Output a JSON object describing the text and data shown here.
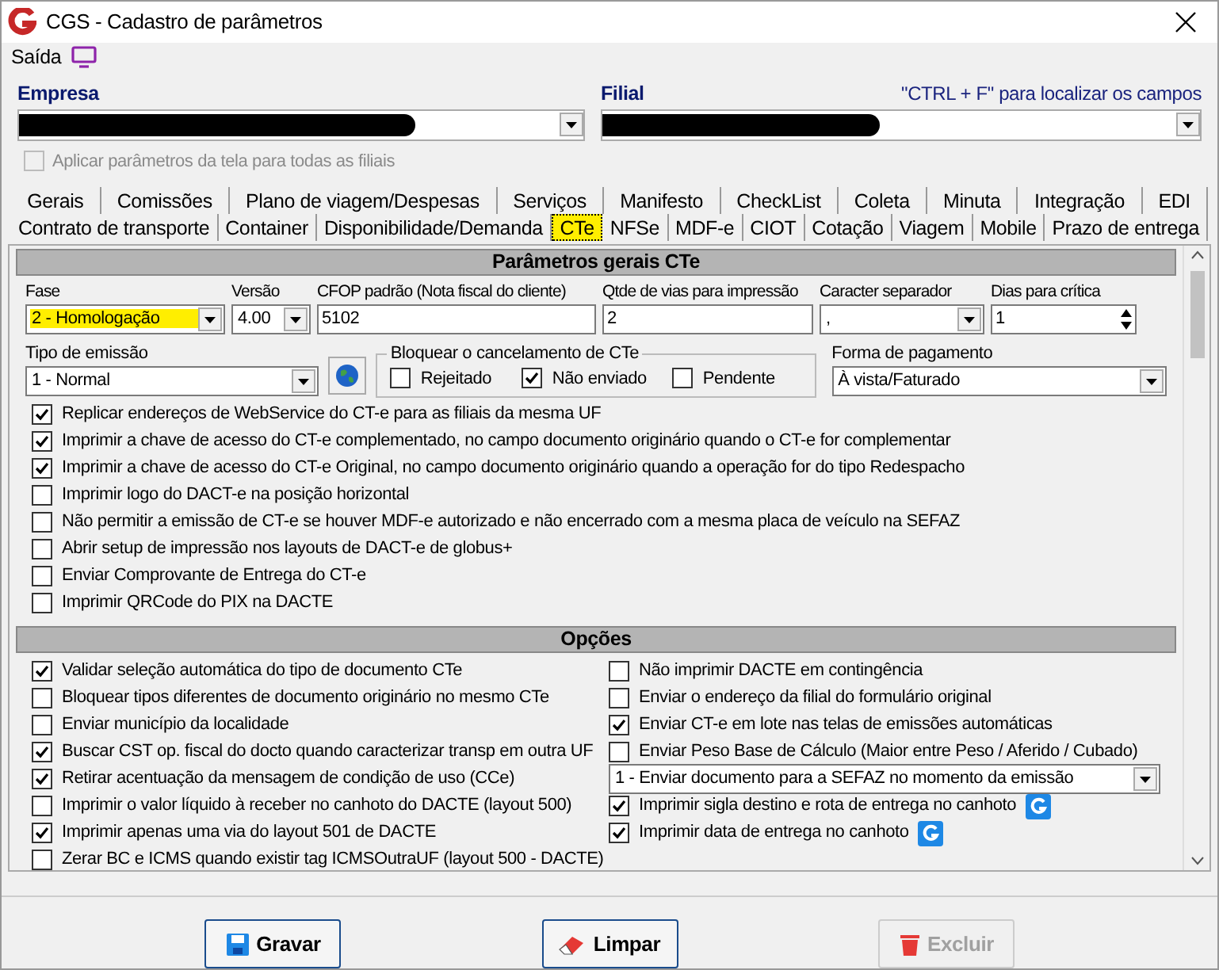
{
  "window": {
    "title": "CGS - Cadastro de parâmetros"
  },
  "toolbar": {
    "exit_label": "Saída"
  },
  "empresa": {
    "label": "Empresa"
  },
  "filial": {
    "label": "Filial",
    "hint": "\"CTRL + F\" para localizar os campos"
  },
  "apply_all": {
    "label": "Aplicar parâmetros da tela para todas as filiais",
    "checked": false,
    "disabled": true
  },
  "tab_rows": [
    [
      {
        "label": "Gerais",
        "selected": false
      },
      {
        "label": "Comissões",
        "selected": false
      },
      {
        "label": "Plano de viagem/Despesas",
        "selected": false
      },
      {
        "label": "Serviços",
        "selected": false
      },
      {
        "label": "Manifesto",
        "selected": false
      },
      {
        "label": "CheckList",
        "selected": false
      },
      {
        "label": "Coleta",
        "selected": false
      },
      {
        "label": "Minuta",
        "selected": false
      },
      {
        "label": "Integração",
        "selected": false
      },
      {
        "label": "EDI",
        "selected": false
      }
    ],
    [
      {
        "label": "Contrato de transporte",
        "selected": false
      },
      {
        "label": "Container",
        "selected": false
      },
      {
        "label": "Disponibilidade/Demanda",
        "selected": false
      },
      {
        "label": "CTe",
        "selected": true
      },
      {
        "label": "NFSe",
        "selected": false
      },
      {
        "label": "MDF-e",
        "selected": false
      },
      {
        "label": "CIOT",
        "selected": false
      },
      {
        "label": "Cotação",
        "selected": false
      },
      {
        "label": "Viagem",
        "selected": false
      },
      {
        "label": "Mobile",
        "selected": false
      },
      {
        "label": "Prazo de entrega",
        "selected": false
      }
    ]
  ],
  "general": {
    "title": "Parâmetros gerais CTe",
    "fields": [
      {
        "label": "Fase",
        "value": "2 - Homologação",
        "kind": "select",
        "highlighted": true
      },
      {
        "label": "Versão",
        "value": "4.00",
        "kind": "select"
      },
      {
        "label": "CFOP padrão (Nota fiscal do cliente)",
        "value": "5102",
        "kind": "text"
      },
      {
        "label": "Qtde de vias para impressão",
        "value": "2",
        "kind": "text"
      },
      {
        "label": "Caracter separador",
        "value": ",",
        "kind": "select"
      },
      {
        "label": "Dias para crítica",
        "value": "1",
        "kind": "spin"
      }
    ],
    "emission_type": {
      "label": "Tipo de emissão",
      "value": "1 - Normal"
    },
    "block_cancel": {
      "title": "Bloquear o cancelamento de CTe",
      "options": [
        {
          "label": "Rejeitado",
          "checked": false
        },
        {
          "label": "Não enviado",
          "checked": true
        },
        {
          "label": "Pendente",
          "checked": false
        }
      ]
    },
    "payment": {
      "label": "Forma de pagamento",
      "value": "À vista/Faturado"
    },
    "checks": [
      {
        "label": "Replicar endereços de WebService do CT-e para as filiais da mesma UF",
        "checked": true
      },
      {
        "label": "Imprimir a chave de acesso do CT-e complementado, no campo documento originário quando o CT-e for complementar",
        "checked": true
      },
      {
        "label": "Imprimir a chave de acesso do CT-e Original, no campo documento originário quando a operação for do tipo Redespacho",
        "checked": true
      },
      {
        "label": "Imprimir logo do DACT-e na posição horizontal",
        "checked": false
      },
      {
        "label": "Não permitir a emissão de CT-e se houver MDF-e autorizado e não encerrado com a mesma placa de veículo na SEFAZ",
        "checked": false
      },
      {
        "label": "Abrir setup de impressão nos layouts de DACT-e de globus+",
        "checked": false
      },
      {
        "label": "Enviar Comprovante de Entrega do CT-e",
        "checked": false
      },
      {
        "label": "Imprimir QRCode do PIX na DACTE",
        "checked": false
      }
    ]
  },
  "options": {
    "title": "Opções",
    "left": [
      {
        "label": "Validar seleção automática do tipo de documento CTe",
        "checked": true
      },
      {
        "label": "Bloquear tipos diferentes de documento originário no mesmo CTe",
        "checked": false
      },
      {
        "label": "Enviar município da localidade",
        "checked": false
      },
      {
        "label": "Buscar CST op. fiscal do docto quando caracterizar transp em outra UF",
        "checked": true
      },
      {
        "label": "Retirar acentuação da mensagem de condição de uso (CCe)",
        "checked": true
      },
      {
        "label": "Imprimir o valor líquido à receber no canhoto do DACTE (layout 500)",
        "checked": false
      },
      {
        "label": "Imprimir apenas uma via do layout 501 de DACTE",
        "checked": true
      },
      {
        "label": "Zerar BC e ICMS quando existir tag ICMSOutraUF (layout 500 - DACTE)",
        "checked": false
      }
    ],
    "right": [
      {
        "kind": "check",
        "label": "Não imprimir DACTE em contingência",
        "checked": false,
        "badge": false
      },
      {
        "kind": "check",
        "label": "Enviar o endereço da filial do formulário original",
        "checked": false,
        "badge": false
      },
      {
        "kind": "check",
        "label": "Enviar CT-e em lote nas telas de emissões automáticas",
        "checked": true,
        "badge": false
      },
      {
        "kind": "check",
        "label": "Enviar Peso Base de Cálculo (Maior entre Peso / Aferido / Cubado)",
        "checked": false,
        "badge": false
      },
      {
        "kind": "select",
        "value": "1 - Enviar documento para a SEFAZ no momento da emissão"
      },
      {
        "kind": "check",
        "label": "Imprimir sigla destino e rota de entrega no canhoto",
        "checked": true,
        "badge": true
      },
      {
        "kind": "check",
        "label": "Imprimir data de entrega no canhoto",
        "checked": true,
        "badge": true
      }
    ]
  },
  "buttons": [
    {
      "label": "Gravar",
      "kind": "save",
      "disabled": false
    },
    {
      "label": "Limpar",
      "kind": "clear",
      "disabled": false
    },
    {
      "label": "Excluir",
      "kind": "delete",
      "disabled": true
    }
  ]
}
